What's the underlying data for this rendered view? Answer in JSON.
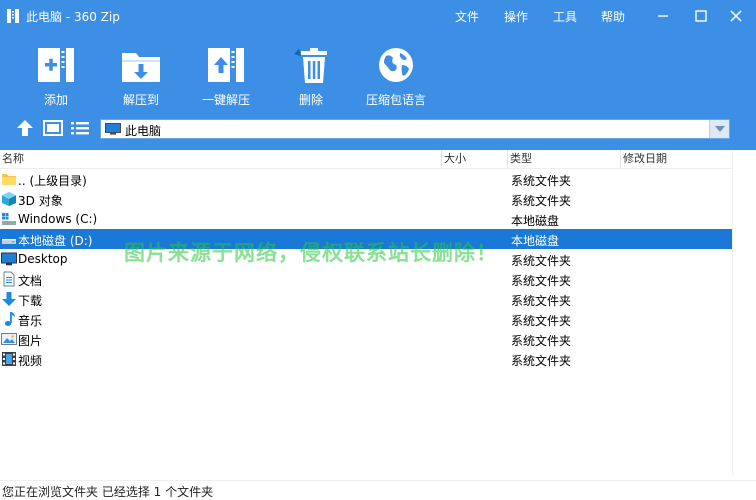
{
  "window": {
    "title": "此电脑 - 360 Zip",
    "menus": [
      "文件",
      "操作",
      "工具",
      "帮助"
    ]
  },
  "toolbar": {
    "add_label": "添加",
    "extract_to_label": "解压到",
    "one_click_extract_label": "一键解压",
    "delete_label": "删除",
    "language_label": "压缩包语言"
  },
  "address": {
    "path": "此电脑"
  },
  "columns": {
    "name": "名称",
    "size": "大小",
    "type": "类型",
    "modified": "修改日期"
  },
  "rows": [
    {
      "name": ".. (上级目录)",
      "type": "系统文件夹",
      "icon": "folder-up-icon"
    },
    {
      "name": "3D 对象",
      "type": "系统文件夹",
      "icon": "3d-objects-icon"
    },
    {
      "name": "Windows (C:)",
      "type": "本地磁盘",
      "icon": "system-drive-icon"
    },
    {
      "name": "本地磁盘 (D:)",
      "type": "本地磁盘",
      "icon": "local-drive-icon",
      "selected": true
    },
    {
      "name": "Desktop",
      "type": "系统文件夹",
      "icon": "desktop-icon"
    },
    {
      "name": "文档",
      "type": "系统文件夹",
      "icon": "documents-icon"
    },
    {
      "name": "下载",
      "type": "系统文件夹",
      "icon": "downloads-icon"
    },
    {
      "name": "音乐",
      "type": "系统文件夹",
      "icon": "music-icon"
    },
    {
      "name": "图片",
      "type": "系统文件夹",
      "icon": "pictures-icon"
    },
    {
      "name": "视频",
      "type": "系统文件夹",
      "icon": "videos-icon"
    }
  ],
  "watermark": "图片来源于网络，侵权联系站长删除！",
  "status": "您正在浏览文件夹 已经选择 1 个文件夹",
  "colors": {
    "header_blue": "#3d8fe5",
    "selection_blue": "#1a78d7"
  }
}
